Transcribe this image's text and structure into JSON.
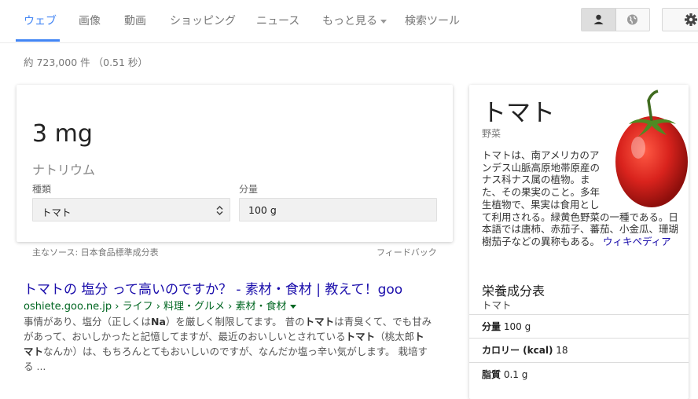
{
  "nav": {
    "tabs": [
      "ウェブ",
      "画像",
      "動画",
      "ショッピング",
      "ニュース",
      "もっと見る",
      "検索ツール"
    ]
  },
  "results": {
    "count": "約 723,000 件 （0.51 秒）"
  },
  "answer": {
    "amount": "3 mg",
    "nutrient": "ナトリウム",
    "type_label": "種類",
    "type_value": "トマト",
    "qty_label": "分量",
    "qty_value": "100 g",
    "source": "主なソース: 日本食品標準成分表",
    "feedback": "フィードバック"
  },
  "result": {
    "title": "トマトの 塩分 って高いのですか？ - 素材・食材 | 教えて！goo",
    "url": "oshiete.goo.ne.jp › ライフ › 料理・グルメ › 素材・食材",
    "snippet": {
      "s1": "事情があり、塩分（正しくは",
      "b1": "Na",
      "s2": "）を厳しく制限してます。 昔の",
      "b2": "トマト",
      "s3": "は青臭くて、でも甘みがあって、おいしかったと記憶してますが、最近のおいしいとされている",
      "b3": "トマト",
      "s4": "（桃太郎",
      "b4": "トマト",
      "s5": "なんか）は、もちろんとてもおいしいのですが、なんだか塩っ辛い気がします。 栽培する ..."
    }
  },
  "panel": {
    "title": "トマト",
    "subtitle": "野菜",
    "description": "トマトは、南アメリカのアンデス山脈高原地帯原産のナス科ナス属の植物。また、その果実のこと。多年生植物で、果実は食用として利用される。緑黄色野菜の一種である。日本語では唐柿、赤茄子、蕃茄、小金瓜、珊瑚樹茄子などの異称もある。",
    "wiki": "ウィキペディア",
    "nutrition_title": "栄養成分表",
    "nutrition_sub": "トマト",
    "rows": [
      {
        "label": "分量",
        "value": "100 g"
      },
      {
        "label": "カロリー (kcal)",
        "value": "18"
      },
      {
        "label": "脂質",
        "value": "0.1 g"
      }
    ]
  },
  "colors": {
    "active_tab": "#4285f4",
    "link": "#1a0dab",
    "url": "#006621",
    "tomato": "#d9231d"
  }
}
